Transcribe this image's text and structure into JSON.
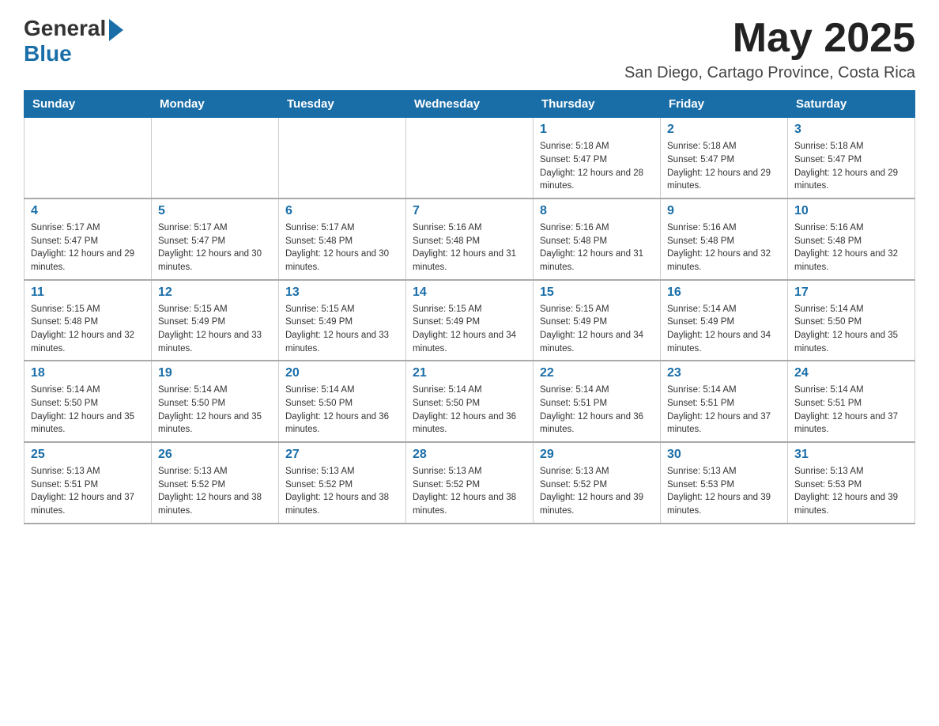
{
  "logo": {
    "general": "General",
    "arrow": "▶",
    "blue": "Blue"
  },
  "title": "May 2025",
  "location": "San Diego, Cartago Province, Costa Rica",
  "days_of_week": [
    "Sunday",
    "Monday",
    "Tuesday",
    "Wednesday",
    "Thursday",
    "Friday",
    "Saturday"
  ],
  "weeks": [
    [
      {
        "day": "",
        "info": ""
      },
      {
        "day": "",
        "info": ""
      },
      {
        "day": "",
        "info": ""
      },
      {
        "day": "",
        "info": ""
      },
      {
        "day": "1",
        "info": "Sunrise: 5:18 AM\nSunset: 5:47 PM\nDaylight: 12 hours and 28 minutes."
      },
      {
        "day": "2",
        "info": "Sunrise: 5:18 AM\nSunset: 5:47 PM\nDaylight: 12 hours and 29 minutes."
      },
      {
        "day": "3",
        "info": "Sunrise: 5:18 AM\nSunset: 5:47 PM\nDaylight: 12 hours and 29 minutes."
      }
    ],
    [
      {
        "day": "4",
        "info": "Sunrise: 5:17 AM\nSunset: 5:47 PM\nDaylight: 12 hours and 29 minutes."
      },
      {
        "day": "5",
        "info": "Sunrise: 5:17 AM\nSunset: 5:47 PM\nDaylight: 12 hours and 30 minutes."
      },
      {
        "day": "6",
        "info": "Sunrise: 5:17 AM\nSunset: 5:48 PM\nDaylight: 12 hours and 30 minutes."
      },
      {
        "day": "7",
        "info": "Sunrise: 5:16 AM\nSunset: 5:48 PM\nDaylight: 12 hours and 31 minutes."
      },
      {
        "day": "8",
        "info": "Sunrise: 5:16 AM\nSunset: 5:48 PM\nDaylight: 12 hours and 31 minutes."
      },
      {
        "day": "9",
        "info": "Sunrise: 5:16 AM\nSunset: 5:48 PM\nDaylight: 12 hours and 32 minutes."
      },
      {
        "day": "10",
        "info": "Sunrise: 5:16 AM\nSunset: 5:48 PM\nDaylight: 12 hours and 32 minutes."
      }
    ],
    [
      {
        "day": "11",
        "info": "Sunrise: 5:15 AM\nSunset: 5:48 PM\nDaylight: 12 hours and 32 minutes."
      },
      {
        "day": "12",
        "info": "Sunrise: 5:15 AM\nSunset: 5:49 PM\nDaylight: 12 hours and 33 minutes."
      },
      {
        "day": "13",
        "info": "Sunrise: 5:15 AM\nSunset: 5:49 PM\nDaylight: 12 hours and 33 minutes."
      },
      {
        "day": "14",
        "info": "Sunrise: 5:15 AM\nSunset: 5:49 PM\nDaylight: 12 hours and 34 minutes."
      },
      {
        "day": "15",
        "info": "Sunrise: 5:15 AM\nSunset: 5:49 PM\nDaylight: 12 hours and 34 minutes."
      },
      {
        "day": "16",
        "info": "Sunrise: 5:14 AM\nSunset: 5:49 PM\nDaylight: 12 hours and 34 minutes."
      },
      {
        "day": "17",
        "info": "Sunrise: 5:14 AM\nSunset: 5:50 PM\nDaylight: 12 hours and 35 minutes."
      }
    ],
    [
      {
        "day": "18",
        "info": "Sunrise: 5:14 AM\nSunset: 5:50 PM\nDaylight: 12 hours and 35 minutes."
      },
      {
        "day": "19",
        "info": "Sunrise: 5:14 AM\nSunset: 5:50 PM\nDaylight: 12 hours and 35 minutes."
      },
      {
        "day": "20",
        "info": "Sunrise: 5:14 AM\nSunset: 5:50 PM\nDaylight: 12 hours and 36 minutes."
      },
      {
        "day": "21",
        "info": "Sunrise: 5:14 AM\nSunset: 5:50 PM\nDaylight: 12 hours and 36 minutes."
      },
      {
        "day": "22",
        "info": "Sunrise: 5:14 AM\nSunset: 5:51 PM\nDaylight: 12 hours and 36 minutes."
      },
      {
        "day": "23",
        "info": "Sunrise: 5:14 AM\nSunset: 5:51 PM\nDaylight: 12 hours and 37 minutes."
      },
      {
        "day": "24",
        "info": "Sunrise: 5:14 AM\nSunset: 5:51 PM\nDaylight: 12 hours and 37 minutes."
      }
    ],
    [
      {
        "day": "25",
        "info": "Sunrise: 5:13 AM\nSunset: 5:51 PM\nDaylight: 12 hours and 37 minutes."
      },
      {
        "day": "26",
        "info": "Sunrise: 5:13 AM\nSunset: 5:52 PM\nDaylight: 12 hours and 38 minutes."
      },
      {
        "day": "27",
        "info": "Sunrise: 5:13 AM\nSunset: 5:52 PM\nDaylight: 12 hours and 38 minutes."
      },
      {
        "day": "28",
        "info": "Sunrise: 5:13 AM\nSunset: 5:52 PM\nDaylight: 12 hours and 38 minutes."
      },
      {
        "day": "29",
        "info": "Sunrise: 5:13 AM\nSunset: 5:52 PM\nDaylight: 12 hours and 39 minutes."
      },
      {
        "day": "30",
        "info": "Sunrise: 5:13 AM\nSunset: 5:53 PM\nDaylight: 12 hours and 39 minutes."
      },
      {
        "day": "31",
        "info": "Sunrise: 5:13 AM\nSunset: 5:53 PM\nDaylight: 12 hours and 39 minutes."
      }
    ]
  ]
}
